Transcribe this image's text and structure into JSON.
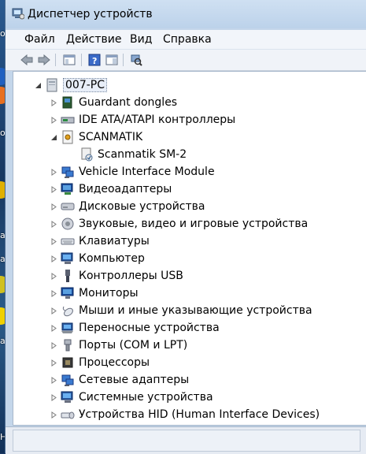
{
  "window": {
    "title": "Диспетчер устройств"
  },
  "menu": [
    "Файл",
    "Действие",
    "Вид",
    "Справка"
  ],
  "desktop_labels": [
    "от",
    "ox",
    "ас",
    "ас",
    "ag",
    "НЬ"
  ],
  "tree": {
    "root": {
      "label": "007-PC",
      "icon": "computer-icon",
      "expanded": true
    },
    "items": [
      {
        "label": "Guardant dongles",
        "icon": "dongle-icon",
        "expanded": false
      },
      {
        "label": "IDE ATA/ATAPI контроллеры",
        "icon": "ide-controller-icon",
        "expanded": false
      },
      {
        "label": "SCANMATIK",
        "icon": "scanmatik-icon",
        "expanded": true,
        "children": [
          {
            "label": "Scanmatik SM-2",
            "icon": "device-icon"
          }
        ]
      },
      {
        "label": "Vehicle Interface Module",
        "icon": "network-device-icon",
        "expanded": false
      },
      {
        "label": "Видеоадаптеры",
        "icon": "display-adapter-icon",
        "expanded": false
      },
      {
        "label": "Дисковые устройства",
        "icon": "disk-drive-icon",
        "expanded": false
      },
      {
        "label": "Звуковые, видео и игровые устройства",
        "icon": "sound-icon",
        "expanded": false
      },
      {
        "label": "Клавиатуры",
        "icon": "keyboard-icon",
        "expanded": false
      },
      {
        "label": "Компьютер",
        "icon": "computer-icon",
        "expanded": false
      },
      {
        "label": "Контроллеры USB",
        "icon": "usb-icon",
        "expanded": false
      },
      {
        "label": "Мониторы",
        "icon": "monitor-icon",
        "expanded": false
      },
      {
        "label": "Мыши и иные указывающие устройства",
        "icon": "mouse-icon",
        "expanded": false
      },
      {
        "label": "Переносные устройства",
        "icon": "portable-device-icon",
        "expanded": false
      },
      {
        "label": "Порты (COM и LPT)",
        "icon": "port-icon",
        "expanded": false
      },
      {
        "label": "Процессоры",
        "icon": "processor-icon",
        "expanded": false
      },
      {
        "label": "Сетевые адаптеры",
        "icon": "network-adapter-icon",
        "expanded": false
      },
      {
        "label": "Системные устройства",
        "icon": "system-device-icon",
        "expanded": false
      },
      {
        "label": "Устройства HID (Human Interface Devices)",
        "icon": "hid-icon",
        "expanded": false
      }
    ]
  },
  "colors": {
    "accent": "#2a5a90",
    "tree_bg": "#ffffff",
    "window_frame": "#c4d6ea"
  }
}
